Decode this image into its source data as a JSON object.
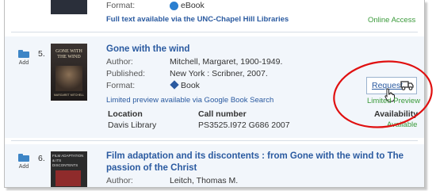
{
  "top": {
    "format_label": "Format:",
    "format_value": "eBook",
    "fulltext_link": "Full text available via the UNC-Chapel Hill Libraries",
    "online_access": "Online Access"
  },
  "results": [
    {
      "number": "5.",
      "add_label": "Add",
      "title": "Gone with the wind",
      "cover_text": "GONE WITH THE WIND",
      "cover_author": "MARGARET MITCHELL",
      "author_label": "Author:",
      "author": "Mitchell, Margaret, 1900-1949.",
      "published_label": "Published:",
      "published": "New York : Scribner, 2007.",
      "format_label": "Format:",
      "format": "Book",
      "preview_link": "Limited preview available via Google Book Search",
      "request_label": "Request",
      "limited_preview": "Limited Preview",
      "availability_header": "Availability",
      "location_header": "Location",
      "callnumber_header": "Call number",
      "location": "Davis Library",
      "callnumber": "PS3525.I972 G686 2007",
      "availability": "Available"
    },
    {
      "number": "6.",
      "add_label": "Add",
      "title": "Film adaptation and its discontents : from Gone with the wind to The passion of the Christ",
      "cover_text": "FILM ADAPTATION & ITS DISCONTENTS",
      "author_label": "Author:",
      "author": "Leitch, Thomas M."
    }
  ],
  "colors": {
    "link": "#2a5aa0",
    "available": "#3a9a3a",
    "highlight_circle": "#e01010"
  }
}
